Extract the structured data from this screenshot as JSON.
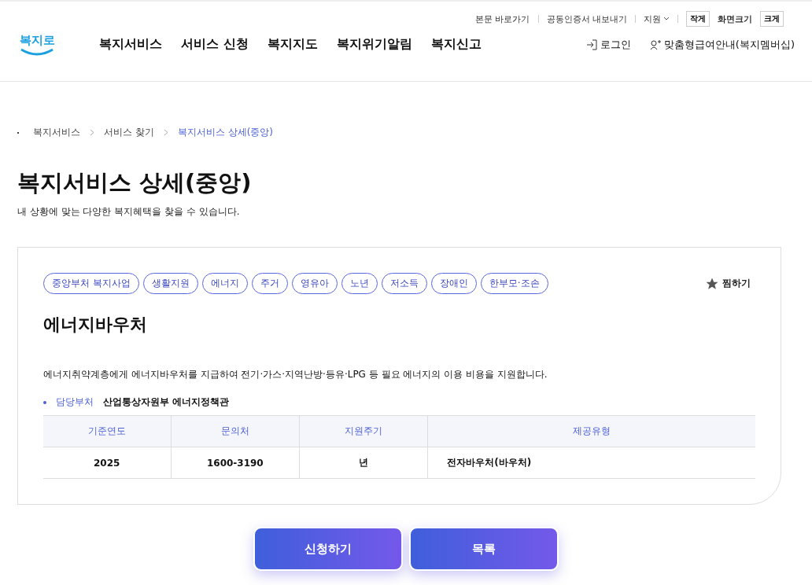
{
  "header": {
    "logo": "복지로",
    "util_links": [
      {
        "label": "본문 바로가기",
        "kind": "link"
      },
      {
        "label": "공동인증서 내보내기",
        "kind": "link"
      },
      {
        "label": "지원",
        "kind": "dropdown"
      }
    ],
    "font_size": {
      "small": "작게",
      "label": "화면크기",
      "large": "크게"
    },
    "nav": [
      "복지서비스",
      "서비스 신청",
      "복지지도",
      "복지위기알림",
      "복지신고"
    ],
    "login": "로그인",
    "membership": "맞춤형급여안내(복지멤버십)"
  },
  "breadcrumb": [
    {
      "label": "복지서비스",
      "selected": false
    },
    {
      "label": "서비스 찾기",
      "selected": false
    },
    {
      "label": "복지서비스 상세(중앙)",
      "selected": true
    }
  ],
  "page_title": "복지서비스 상세(중앙)",
  "page_subtitle": "내 상황에 맞는 다양한 복지혜택을 찾을 수 있습니다.",
  "card": {
    "tags": [
      "중앙부처 복지사업",
      "생활지원",
      "에너지",
      "주거",
      "영유아",
      "노년",
      "저소득",
      "장애인",
      "한부모·조손"
    ],
    "favorite": {
      "label": "찜하기",
      "selected": false
    },
    "title": "에너지바우처",
    "description": "에너지취약계층에게 에너지바우처를 지급하여 전기·가스·지역난방·등유·LPG 등 필요 에너지의 이용 비용을 지원합니다.",
    "department": {
      "label": "담당부처",
      "value": "산업통상자원부 에너지정책관"
    },
    "table": {
      "columns": [
        "기준연도",
        "문의처",
        "지원주기",
        "제공유형"
      ],
      "rows": [
        [
          "2025",
          "1600-3190",
          "년",
          "전자바우처(바우처)"
        ]
      ]
    }
  },
  "buttons": [
    "신청하기",
    "목록"
  ]
}
